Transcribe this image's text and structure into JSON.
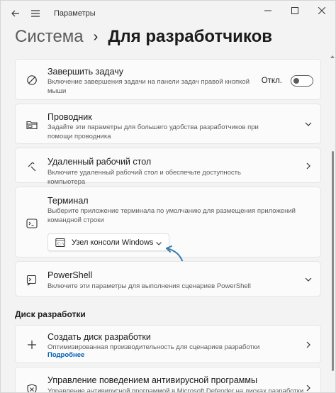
{
  "window": {
    "title": "Параметры",
    "back_icon": "back-arrow-icon",
    "menu_icon": "hamburger-menu-icon"
  },
  "breadcrumb": {
    "parent": "Система",
    "separator": "›",
    "current": "Для разработчиков"
  },
  "cards": {
    "end_task": {
      "title": "Завершить задачу",
      "desc": "Включение завершения задачи на панели задач правой кнопкой мыши",
      "toggle_label": "Откл.",
      "toggle_on": false
    },
    "explorer": {
      "title": "Проводник",
      "desc": "Задайте эти параметры для большего удобства разработчиков при помощи проводника"
    },
    "remote_desktop": {
      "title": "Удаленный рабочий стол",
      "desc": "Включите удаленный рабочий стол и обеспечьте доступность компьютера"
    },
    "terminal": {
      "title": "Терминал",
      "desc": "Выберите приложение терминала по умолчанию для размещения приложений командной строки",
      "selected_value": "Узел консоли Windows"
    },
    "powershell": {
      "title": "PowerShell",
      "desc": "Включите эти параметры для выполнения сценариев PowerShell"
    }
  },
  "dev_drive": {
    "section_label": "Диск разработки",
    "create": {
      "title": "Создать диск разработки",
      "desc": "Оптимизированная производительность для сценариев разработки",
      "link": "Подробнее"
    },
    "antivirus": {
      "title": "Управление поведением антивирусной программы",
      "desc": "Управление антивирусной программой в Microsoft Defender на дисках разработки"
    }
  },
  "colors": {
    "accent": "#005fb8",
    "annotation_arrow": "#3a7ca8"
  }
}
